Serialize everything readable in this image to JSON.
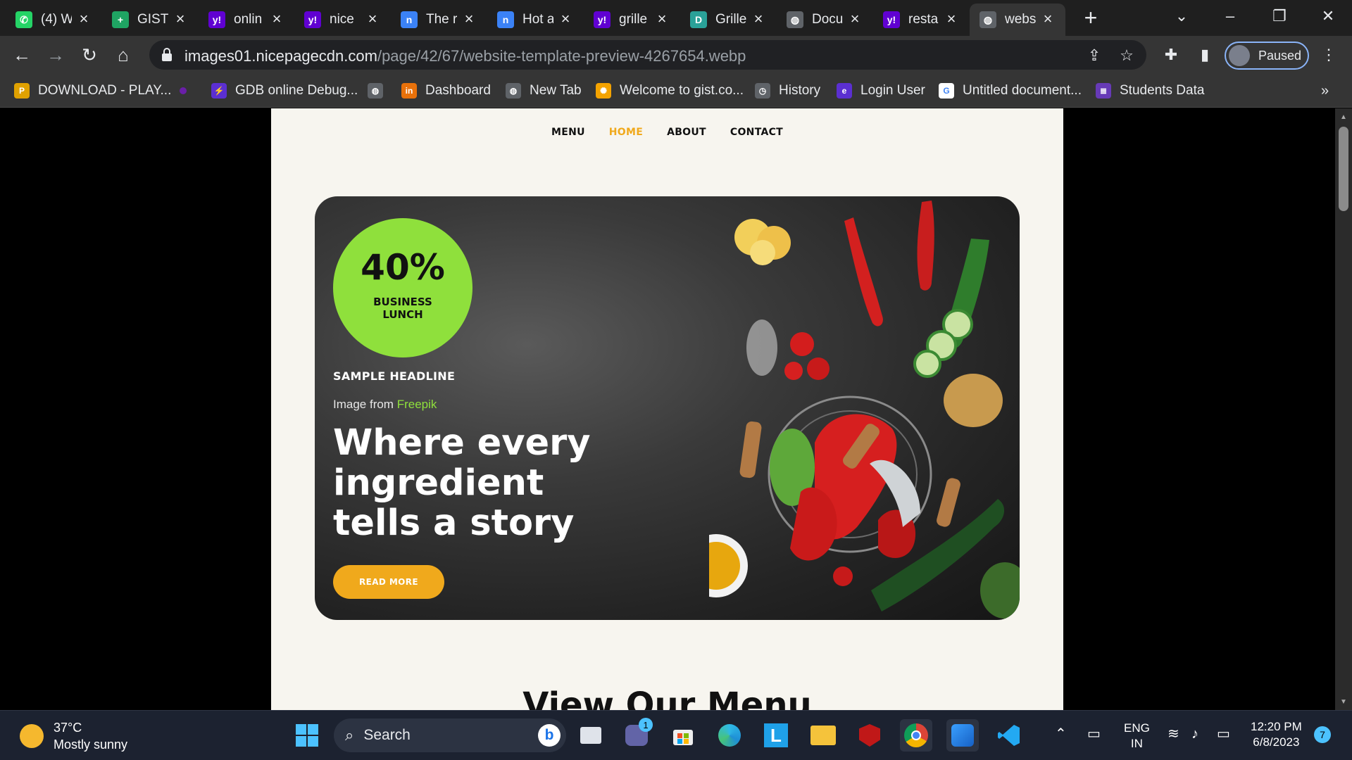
{
  "browser": {
    "tabs": [
      {
        "title": "(4) W",
        "icon": "whatsapp-icon",
        "color": "#25d366",
        "glyph": "✆"
      },
      {
        "title": "GIST_",
        "icon": "sheets-icon",
        "color": "#1fa463",
        "glyph": "+"
      },
      {
        "title": "onlin",
        "icon": "yahoo-icon",
        "color": "#6001d2",
        "glyph": "y!"
      },
      {
        "title": "nice",
        "icon": "yahoo-icon",
        "color": "#6001d2",
        "glyph": "y!"
      },
      {
        "title": "The r",
        "icon": "nicepage-icon",
        "color": "#3b82f6",
        "glyph": "n"
      },
      {
        "title": "Hot a",
        "icon": "nicepage-icon",
        "color": "#3b82f6",
        "glyph": "n"
      },
      {
        "title": "grille",
        "icon": "yahoo-icon",
        "color": "#6001d2",
        "glyph": "y!"
      },
      {
        "title": "Grille",
        "icon": "site-icon",
        "color": "#2aa198",
        "glyph": "D"
      },
      {
        "title": "Docu",
        "icon": "globe-icon",
        "color": "#5f6368",
        "glyph": "◍"
      },
      {
        "title": "resta",
        "icon": "yahoo-icon",
        "color": "#6001d2",
        "glyph": "y!"
      },
      {
        "title": "webs",
        "icon": "globe-icon",
        "color": "#5f6368",
        "glyph": "◍"
      }
    ],
    "url_host": "images01.nicepagecdn.com",
    "url_path": "/page/42/67/website-template-preview-4267654.webp",
    "profile_label": "Paused",
    "bookmarks": [
      {
        "label": "DOWNLOAD - PLAY...",
        "icon": "pubg-icon",
        "color": "#e0a100",
        "glyph": "P"
      },
      {
        "label": "",
        "icon": "dot-icon",
        "color": "#6a1fa8",
        "glyph": ""
      },
      {
        "label": "GDB online Debug...",
        "icon": "gdb-icon",
        "color": "#5b2fd1",
        "glyph": "⚡"
      },
      {
        "label": "",
        "icon": "globe-icon",
        "color": "#5f6368",
        "glyph": "◍"
      },
      {
        "label": "Dashboard",
        "icon": "dashboard-icon",
        "color": "#e8710a",
        "glyph": "in"
      },
      {
        "label": "New Tab",
        "icon": "globe-icon",
        "color": "#5f6368",
        "glyph": "◍"
      },
      {
        "label": "Welcome to gist.co...",
        "icon": "gist-icon",
        "color": "#f4a300",
        "glyph": "✺"
      },
      {
        "label": "History",
        "icon": "history-icon",
        "color": "#5f6368",
        "glyph": "◷"
      },
      {
        "label": "Login User",
        "icon": "login-icon",
        "color": "#5b2fd1",
        "glyph": "e"
      },
      {
        "label": "Untitled document...",
        "icon": "google-icon",
        "color": "#ffffff",
        "glyph": "G"
      },
      {
        "label": "Students Data",
        "icon": "forms-icon",
        "color": "#673ab7",
        "glyph": "≣"
      }
    ]
  },
  "site": {
    "nav": [
      "MENU",
      "HOME",
      "ABOUT",
      "CONTACT"
    ],
    "active_nav": "HOME",
    "badge_pct": "40%",
    "badge_line1": "BUSINESS",
    "badge_line2": "LUNCH",
    "headline": "SAMPLE HEADLINE",
    "credit_prefix": "Image from ",
    "credit_link": "Freepik",
    "title": "Where every ingredient tells a story",
    "cta": "READ MORE",
    "section_title": "View Our Menu",
    "colors": {
      "accent": "#f0a91c",
      "badge": "#8fe03c",
      "page_bg": "#f7f5ef"
    }
  },
  "taskbar": {
    "temp": "37°C",
    "condition": "Mostly sunny",
    "search_label": "Search",
    "lang1": "ENG",
    "lang2": "IN",
    "time": "12:20 PM",
    "date": "6/8/2023",
    "notif_count": "7",
    "teams_badge": "1"
  }
}
